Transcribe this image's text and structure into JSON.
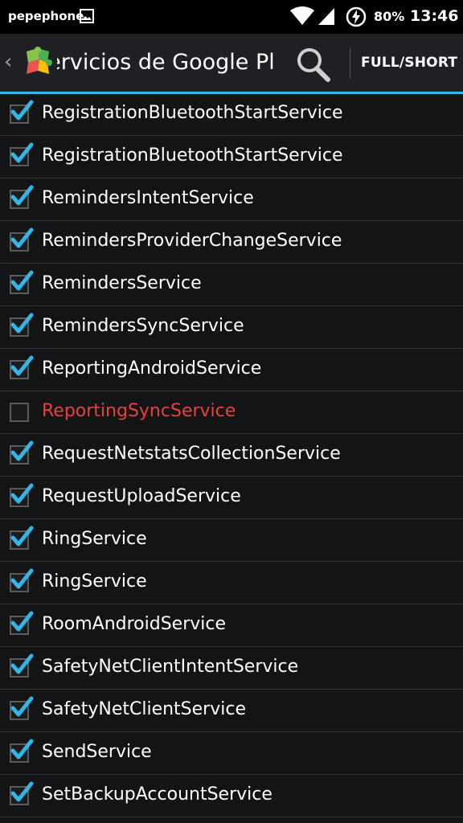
{
  "status_bar": {
    "carrier": "pepephone",
    "battery": "80%",
    "time": "13:46",
    "icons": [
      "image-icon",
      "wifi-icon",
      "cell-signal-icon",
      "battery-charging-icon"
    ]
  },
  "action_bar": {
    "title": "Servicios de Google Play",
    "full_short_label": "FULL/SHORT",
    "accent_color": "#33b5e5"
  },
  "colors": {
    "disabled_service": "#e8413c",
    "check": "#33b5e5"
  },
  "services": [
    {
      "name": "RegistrationBluetoothStartService",
      "enabled": true
    },
    {
      "name": "RegistrationBluetoothStartService",
      "enabled": true
    },
    {
      "name": "RemindersIntentService",
      "enabled": true
    },
    {
      "name": "RemindersProviderChangeService",
      "enabled": true
    },
    {
      "name": "RemindersService",
      "enabled": true
    },
    {
      "name": "RemindersSyncService",
      "enabled": true
    },
    {
      "name": "ReportingAndroidService",
      "enabled": true
    },
    {
      "name": "ReportingSyncService",
      "enabled": false
    },
    {
      "name": "RequestNetstatsCollectionService",
      "enabled": true
    },
    {
      "name": "RequestUploadService",
      "enabled": true
    },
    {
      "name": "RingService",
      "enabled": true
    },
    {
      "name": "RingService",
      "enabled": true
    },
    {
      "name": "RoomAndroidService",
      "enabled": true
    },
    {
      "name": "SafetyNetClientIntentService",
      "enabled": true
    },
    {
      "name": "SafetyNetClientService",
      "enabled": true
    },
    {
      "name": "SendService",
      "enabled": true
    },
    {
      "name": "SetBackupAccountService",
      "enabled": true
    },
    {
      "name": "",
      "enabled": true
    }
  ]
}
